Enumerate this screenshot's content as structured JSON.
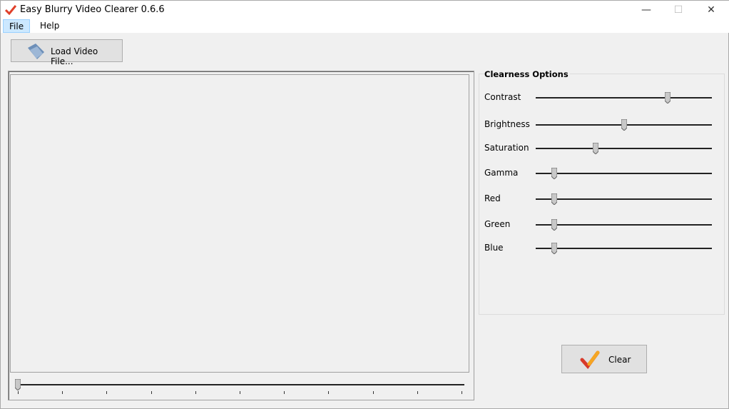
{
  "window": {
    "title": "Easy Blurry Video Clearer 0.6.6",
    "minimize": "—",
    "maximize": "☐",
    "close": "✕"
  },
  "menu": [
    {
      "label": "File"
    },
    {
      "label": "Help"
    }
  ],
  "toolbar": {
    "load_label": "Load Video File..."
  },
  "options": {
    "title": "Clearness Options",
    "sliders": [
      {
        "label": "Contrast",
        "value": 0.75
      },
      {
        "label": "Brightness",
        "value": 0.5
      },
      {
        "label": "Saturation",
        "value": 0.34
      },
      {
        "label": "Gamma",
        "value": 0.105
      },
      {
        "label": "Red",
        "value": 0.105
      },
      {
        "label": "Green",
        "value": 0.105
      },
      {
        "label": "Blue",
        "value": 0.105
      }
    ]
  },
  "timeline": {
    "value": 0,
    "ticks": 11
  },
  "clear_button": {
    "label": "Clear"
  }
}
